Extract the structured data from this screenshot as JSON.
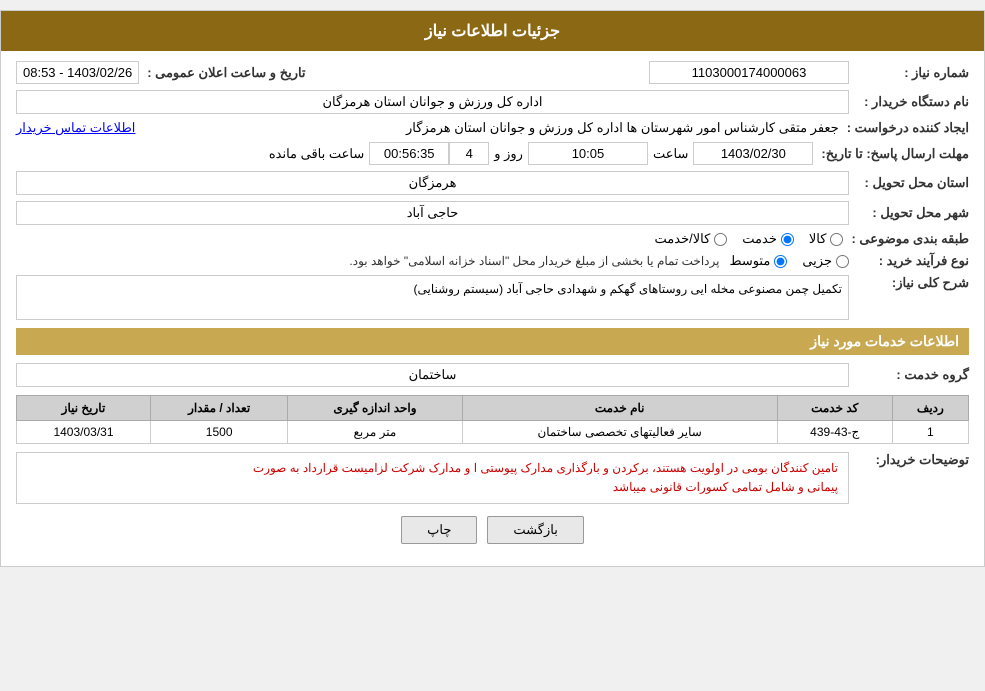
{
  "header": {
    "title": "جزئیات اطلاعات نیاز"
  },
  "fields": {
    "need_number_label": "شماره نیاز :",
    "need_number_value": "1103000174000063",
    "announce_date_label": "تاریخ و ساعت اعلان عمومی :",
    "announce_date_value": "1403/02/26 - 08:53",
    "buyer_org_label": "نام دستگاه خریدار :",
    "buyer_org_value": "اداره کل ورزش و جوانان استان هرمزگان",
    "creator_label": "ایجاد کننده درخواست :",
    "creator_value": "جعفر متقی کارشناس امور شهرستان ها اداره کل ورزش و جوانان استان هرمزگار",
    "creator_link": "اطلاعات تماس خریدار",
    "reply_deadline_label": "مهلت ارسال پاسخ: تا تاریخ:",
    "reply_date": "1403/02/30",
    "reply_time_label": "ساعت",
    "reply_time": "10:05",
    "reply_day_label": "روز و",
    "reply_day": "4",
    "reply_remaining_label": "ساعت باقی مانده",
    "reply_remaining": "00:56:35",
    "province_label": "استان محل تحویل :",
    "province_value": "هرمزگان",
    "city_label": "شهر محل تحویل :",
    "city_value": "حاجی آباد",
    "category_label": "طبقه بندی موضوعی :",
    "category_kala": "کالا",
    "category_khedmat": "خدمت",
    "category_kala_khedmat": "کالا/خدمت",
    "category_selected": "khedmat",
    "process_label": "نوع فرآیند خرید :",
    "process_jazei": "جزیی",
    "process_motavasset": "متوسط",
    "process_note": "پرداخت تمام یا بخشی از مبلغ خریدار محل \"اسناد خزانه اسلامی\" خواهد بود.",
    "need_desc_label": "شرح کلی نیاز:",
    "need_desc_value": "تکمیل چمن مصنوعی مخله ایی روستاهای گهکم و شهدادی حاجی آباد (سیستم روشنایی)",
    "services_section": "اطلاعات خدمات مورد نیاز",
    "group_label": "گروه خدمت :",
    "group_value": "ساختمان",
    "table": {
      "headers": [
        "ردیف",
        "کد خدمت",
        "نام خدمت",
        "واحد اندازه گیری",
        "تعداد / مقدار",
        "تاریخ نیاز"
      ],
      "rows": [
        {
          "row": "1",
          "code": "ج-43-439",
          "name": "سایر فعالیتهای تخصصی ساختمان",
          "unit": "متر مربع",
          "count": "1500",
          "date": "1403/03/31"
        }
      ]
    },
    "buyer_notes_label": "توضیحات خریدار:",
    "buyer_notes_line1": "تامین کنندگان بومی در اولویت هستند، برکردن و بارگذاری مدارک پیوستی ا و مدارک شرکت لزامیست  قرارداد به صورت",
    "buyer_notes_line2": "پیمانی و شامل تمامی کسورات قانونی میباشد"
  },
  "buttons": {
    "print_label": "چاپ",
    "back_label": "بازگشت"
  }
}
